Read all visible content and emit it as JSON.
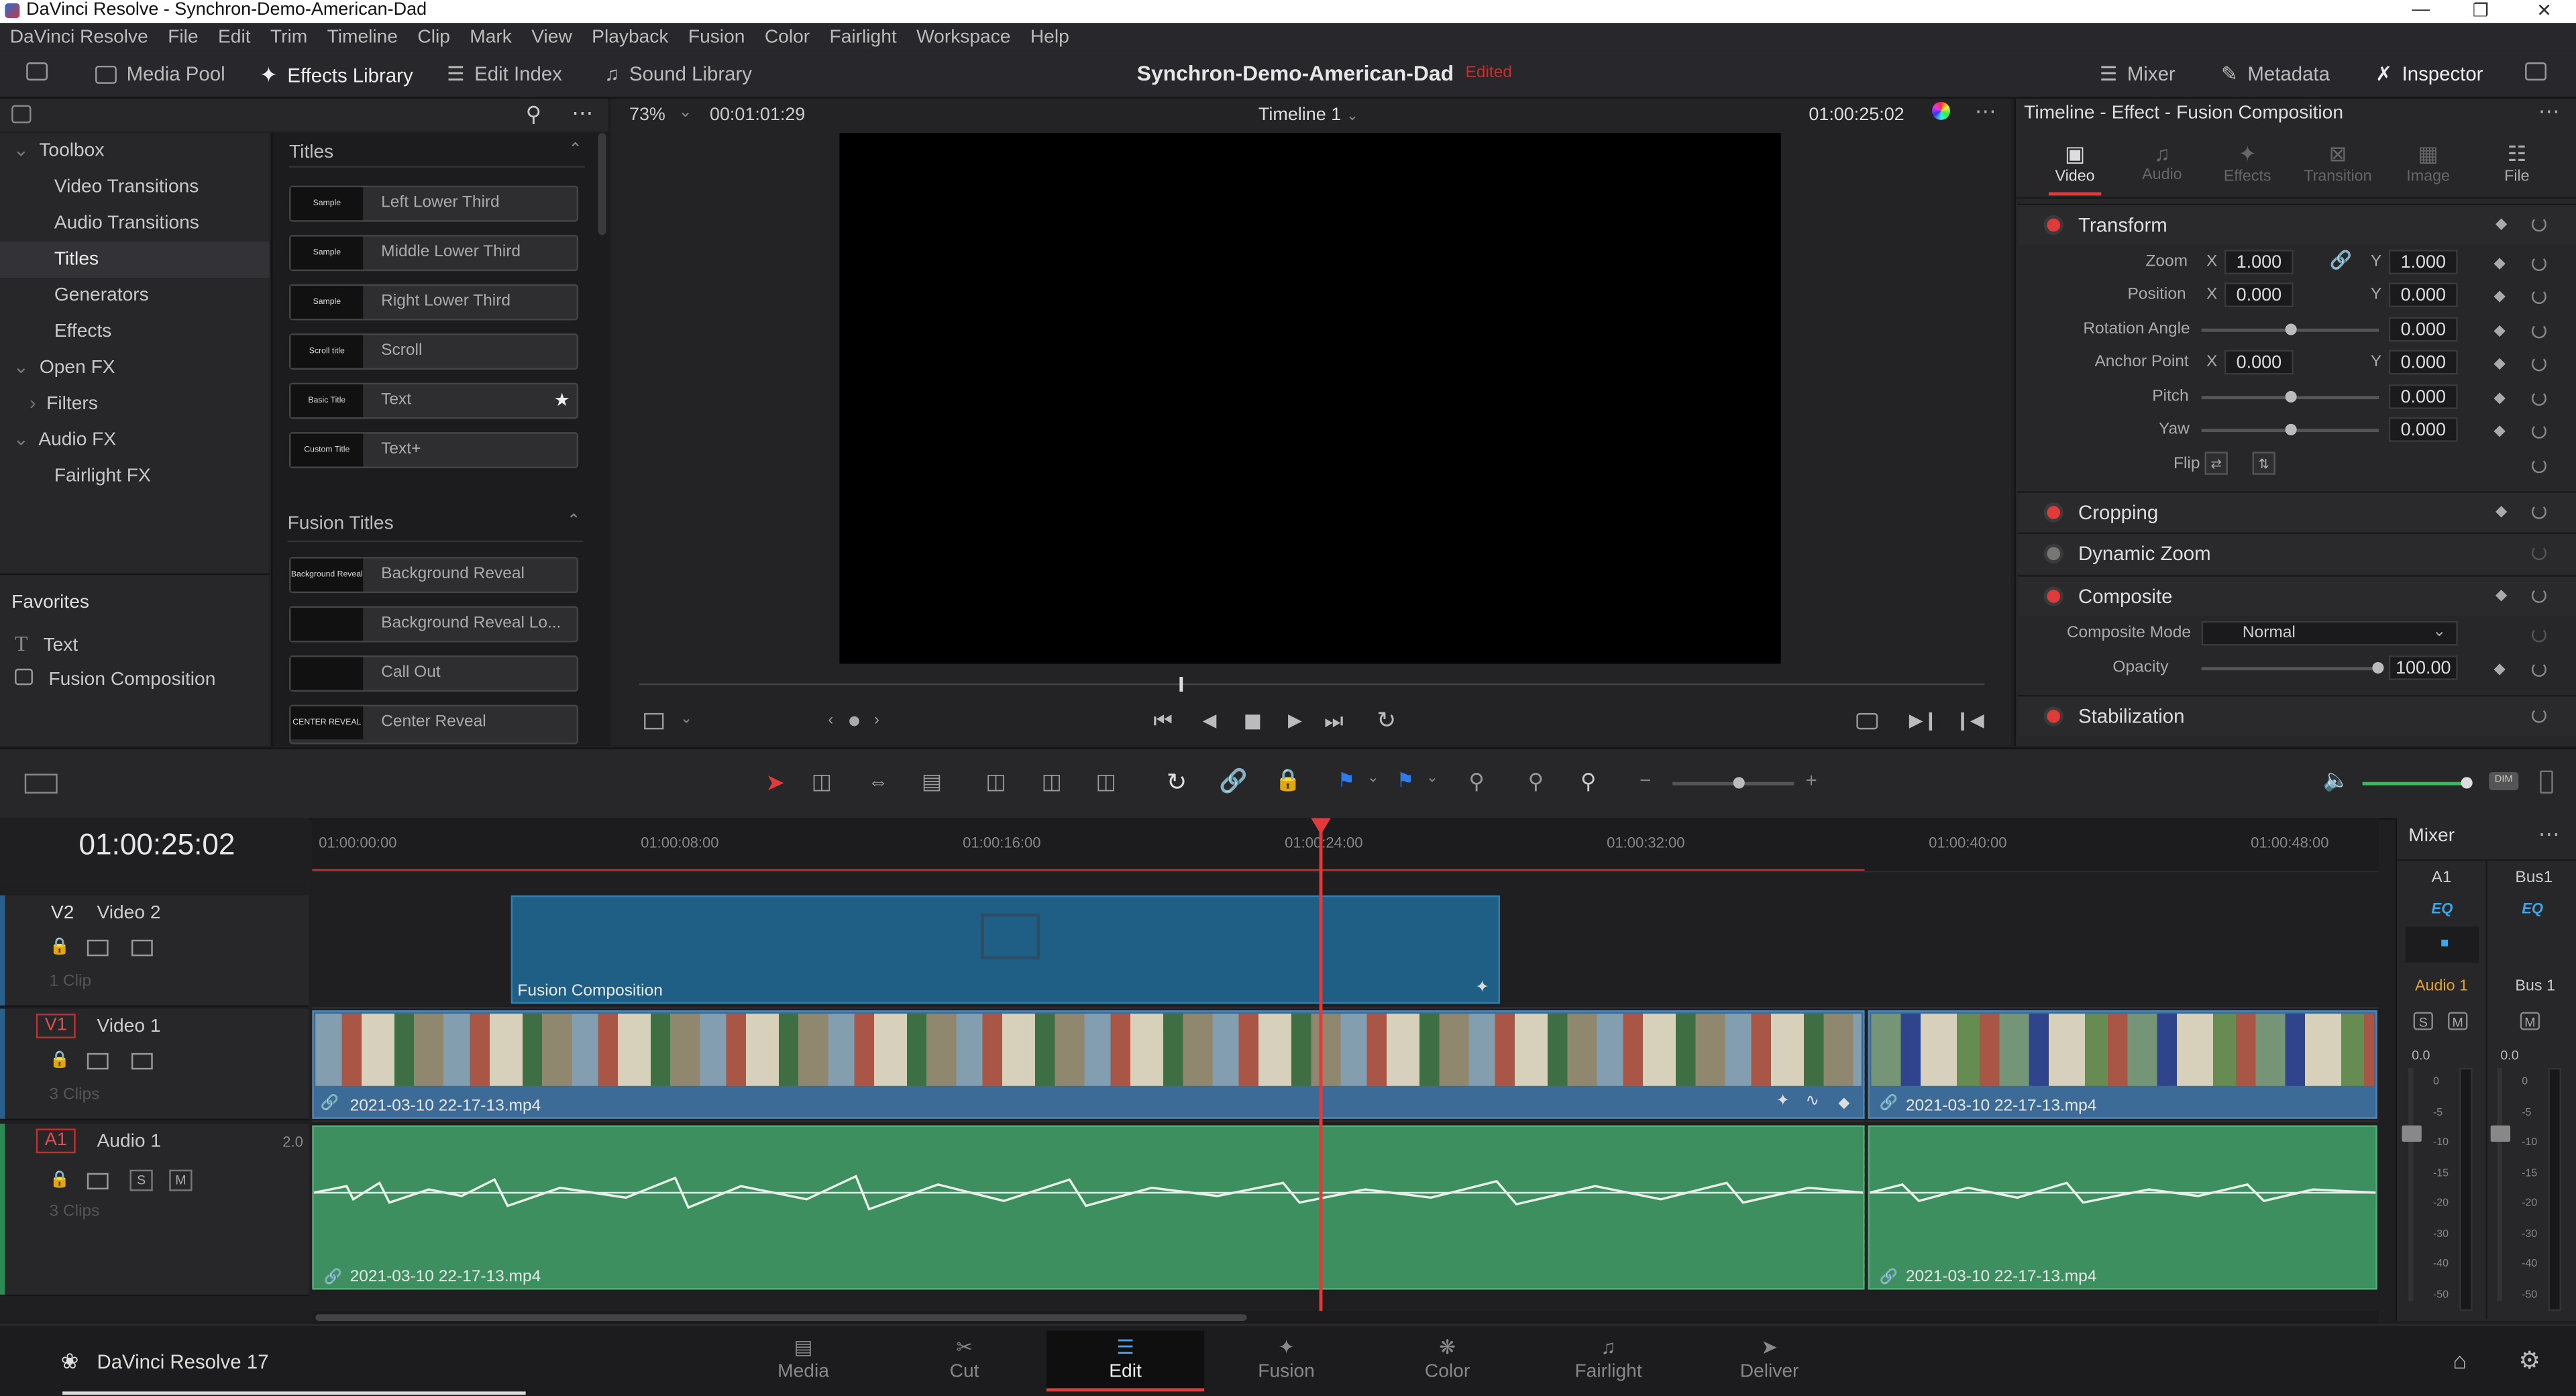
{
  "window": {
    "title": "DaVinci Resolve - Synchron-Demo-American-Dad"
  },
  "menu": [
    "DaVinci Resolve",
    "File",
    "Edit",
    "Trim",
    "Timeline",
    "Clip",
    "Mark",
    "View",
    "Playback",
    "Fusion",
    "Color",
    "Fairlight",
    "Workspace",
    "Help"
  ],
  "toolbar": {
    "media_pool": "Media Pool",
    "effects_library": "Effects Library",
    "edit_index": "Edit Index",
    "sound_library": "Sound Library",
    "project_name": "Synchron-Demo-American-Dad",
    "edited": "Edited",
    "mixer": "Mixer",
    "metadata": "Metadata",
    "inspector": "Inspector"
  },
  "toolbox": {
    "items": [
      {
        "label": "Toolbox",
        "level": 0,
        "expanded": true
      },
      {
        "label": "Video Transitions",
        "level": 1
      },
      {
        "label": "Audio Transitions",
        "level": 1
      },
      {
        "label": "Titles",
        "level": 1,
        "selected": true
      },
      {
        "label": "Generators",
        "level": 1
      },
      {
        "label": "Effects",
        "level": 1
      },
      {
        "label": "Open FX",
        "level": 0,
        "expanded": true
      },
      {
        "label": "Filters",
        "level": 1,
        "collapsed": true
      },
      {
        "label": "Audio FX",
        "level": 0,
        "expanded": true
      },
      {
        "label": "Fairlight FX",
        "level": 1
      }
    ],
    "favorites_title": "Favorites",
    "favorites": [
      {
        "label": "Text",
        "icon": "text-T-icon"
      },
      {
        "label": "Fusion Composition",
        "icon": "fusion-composition-icon"
      }
    ]
  },
  "titles": {
    "section1": "Titles",
    "items": [
      {
        "label": "Left Lower Third",
        "thumb": "Sample"
      },
      {
        "label": "Middle Lower Third",
        "thumb": "Sample"
      },
      {
        "label": "Right Lower Third",
        "thumb": "Sample"
      },
      {
        "label": "Scroll",
        "thumb": "Scroll title"
      },
      {
        "label": "Text",
        "thumb": "Basic Title",
        "favorite": true
      },
      {
        "label": "Text+",
        "thumb": "Custom Title"
      }
    ],
    "section2": "Fusion Titles",
    "fusion_items": [
      {
        "label": "Background Reveal",
        "thumb": "Background Reveal"
      },
      {
        "label": "Background Reveal Lo...",
        "thumb": ""
      },
      {
        "label": "Call Out",
        "thumb": ""
      },
      {
        "label": "Center Reveal",
        "thumb": "CENTER REVEAL"
      }
    ]
  },
  "viewer": {
    "zoom": "73%",
    "duration": "00:01:01:29",
    "timeline_name": "Timeline 1",
    "timecode": "01:00:25:02"
  },
  "inspector": {
    "header": "Timeline - Effect - Fusion Composition",
    "tabs": [
      "Video",
      "Audio",
      "Effects",
      "Transition",
      "Image",
      "File"
    ],
    "transform": {
      "title": "Transform",
      "zoom_label": "Zoom",
      "zoom_x": "1.000",
      "zoom_y": "1.000",
      "position_label": "Position",
      "pos_x": "0.000",
      "pos_y": "0.000",
      "rotation_label": "Rotation Angle",
      "rotation": "0.000",
      "anchor_label": "Anchor Point",
      "anchor_x": "0.000",
      "anchor_y": "0.000",
      "pitch_label": "Pitch",
      "pitch": "0.000",
      "yaw_label": "Yaw",
      "yaw": "0.000",
      "flip_label": "Flip",
      "x": "X",
      "y": "Y"
    },
    "cropping": "Cropping",
    "dynamic_zoom": "Dynamic Zoom",
    "composite": {
      "title": "Composite",
      "mode_label": "Composite Mode",
      "mode": "Normal",
      "opacity_label": "Opacity",
      "opacity": "100.00"
    },
    "stabilization": "Stabilization"
  },
  "timeline": {
    "timecode": "01:00:25:02",
    "ruler": [
      "01:00:00:00",
      "01:00:08:00",
      "01:00:16:00",
      "01:00:24:00",
      "01:00:32:00",
      "01:00:40:00",
      "01:00:48:00"
    ],
    "tracks": [
      {
        "id": "V2",
        "name": "Video 2",
        "clips": "1 Clip"
      },
      {
        "id": "V1",
        "name": "Video 1",
        "clips": "3 Clips"
      },
      {
        "id": "A1",
        "name": "Audio 1",
        "level": "2.0",
        "clips": "3 Clips"
      }
    ],
    "fusion_clip": "Fusion Composition",
    "video_clip_a": "2021-03-10 22-17-13.mp4",
    "video_clip_b": "2021-03-10 22-17-13.mp4",
    "audio_clip_a": "2021-03-10 22-17-13.mp4",
    "audio_clip_b": "2021-03-10 22-17-13.mp4"
  },
  "mixer": {
    "title": "Mixer",
    "channels": [
      "A1",
      "Bus1"
    ],
    "eq": "EQ",
    "names": [
      "Audio 1",
      "Bus 1"
    ],
    "mute": "M",
    "solo": "S",
    "db": "0.0",
    "scale": [
      "0",
      "-5",
      "-10",
      "-15",
      "-20",
      "-30",
      "-40",
      "-50"
    ]
  },
  "pages": [
    "Media",
    "Cut",
    "Edit",
    "Fusion",
    "Color",
    "Fairlight",
    "Deliver"
  ],
  "active_page": "Edit",
  "brand": "DaVinci Resolve 17",
  "colors": {
    "accent_red": "#e03b3b",
    "fusion_clip": "#1f5f86",
    "video_clip": "#3b6b96",
    "audio_clip": "#3d8f5f",
    "playhead": "#e23a3a"
  }
}
